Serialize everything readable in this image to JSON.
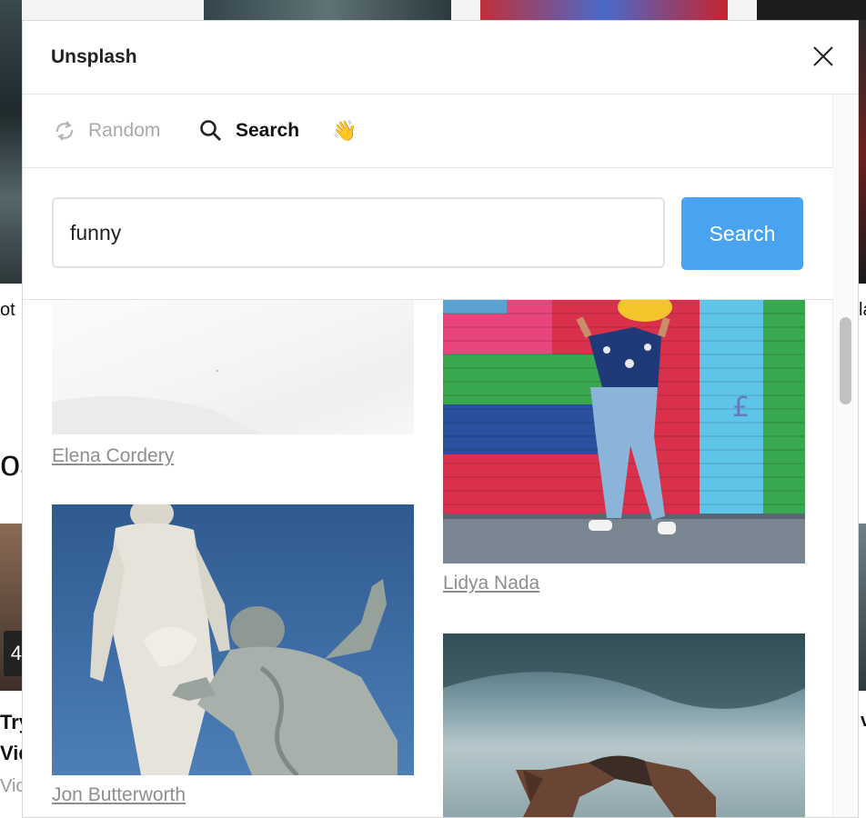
{
  "modal": {
    "title": "Unsplash",
    "tabs": [
      {
        "label": "Random",
        "icon": "refresh-icon",
        "active": false
      },
      {
        "label": "Search",
        "icon": "search-icon",
        "active": true
      },
      {
        "label": "👋",
        "icon": "waving-hand-icon",
        "active": false
      }
    ],
    "search": {
      "value": "funny",
      "placeholder": "",
      "button_label": "Search"
    },
    "results": [
      {
        "author": "Elena Cordery",
        "column": 1
      },
      {
        "author": "Lidya Nada",
        "column": 2
      },
      {
        "author": "Jon Butterworth",
        "column": 1
      },
      {
        "author": "",
        "column": 2
      }
    ]
  },
  "background_page": {
    "fragments": [
      "ot",
      "la",
      "os",
      "Try",
      "Vid",
      "Vict",
      "4",
      "v"
    ]
  },
  "colors": {
    "accent": "#4aa3f0",
    "muted_text": "#a9a9a9",
    "credit_text": "#8e8e8e",
    "border": "#e3e3e3"
  }
}
